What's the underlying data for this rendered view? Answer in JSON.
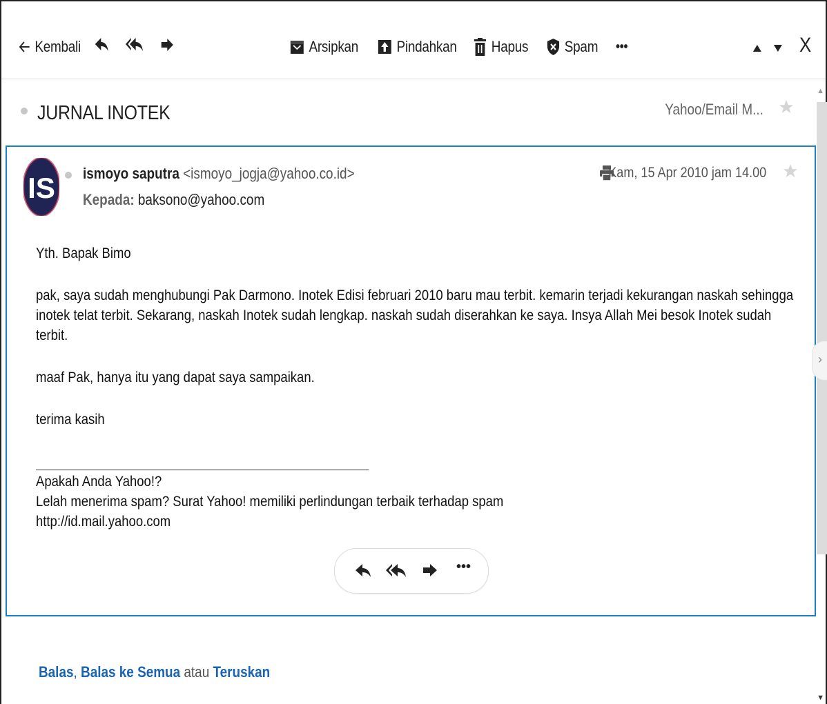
{
  "toolbar": {
    "back_label": "Kembali",
    "archive_label": "Arsipkan",
    "move_label": "Pindahkan",
    "delete_label": "Hapus",
    "spam_label": "Spam",
    "more_label": "•••",
    "close_label": "X"
  },
  "message": {
    "subject": "JURNAL INOTEK",
    "folder": "Yahoo/Email M...",
    "avatar_initials": "IS",
    "sender_name": "ismoyo saputra",
    "sender_email": "<ismoyo_jogja@yahoo.co.id>",
    "to_label": "Kepada:",
    "to_address": "baksono@yahoo.com",
    "date": "Kam, 15 Apr 2010 jam 14.00",
    "body": {
      "greeting": "Yth. Bapak Bimo",
      "paragraph1_line1": "pak, saya sudah menghubungi Pak Darmono. Inotek Edisi februari 2010 baru mau terbit. kemarin terjadi kekurangan naskah sehingga",
      "paragraph1_line2": "inotek telat terbit. Sekarang, naskah Inotek sudah lengkap. naskah sudah diserahkan ke saya. Insya Allah Mei besok Inotek sudah terbit.",
      "paragraph2": "maaf Pak, hanya itu yang dapat saya sampaikan.",
      "closing": "terima kasih",
      "signature_line1": "Apakah Anda Yahoo!?",
      "signature_line2": "Lelah menerima spam? Surat Yahoo! memiliki perlindungan terbaik terhadap spam",
      "signature_line3": "http://id.mail.yahoo.com"
    }
  },
  "footer": {
    "reply": "Balas",
    "comma": ",",
    "reply_all": "Balas ke Semua",
    "or": "atau",
    "forward": "Teruskan"
  }
}
